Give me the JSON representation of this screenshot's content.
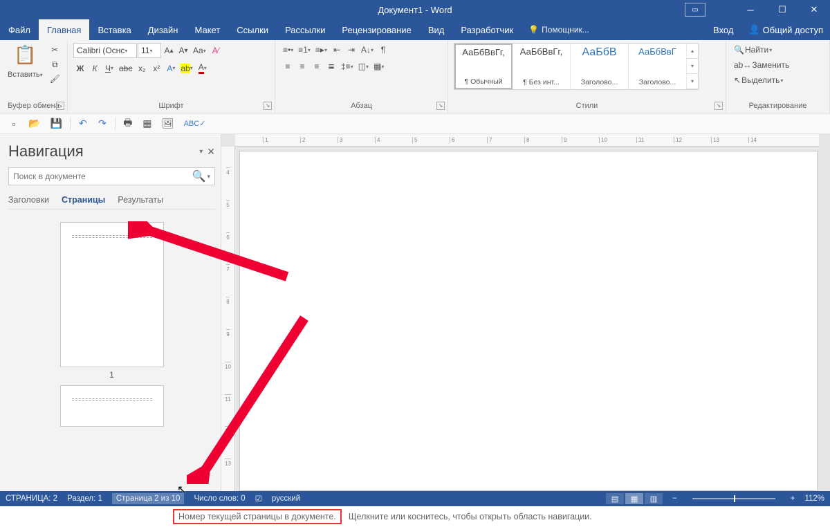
{
  "title": "Документ1 - Word",
  "tabs": {
    "file": "Файл",
    "home": "Главная",
    "insert": "Вставка",
    "design": "Дизайн",
    "layout": "Макет",
    "references": "Ссылки",
    "mailings": "Рассылки",
    "review": "Рецензирование",
    "view": "Вид",
    "developer": "Разработчик",
    "tellme": "Помощник...",
    "signin": "Вход",
    "share": "Общий доступ"
  },
  "ribbon": {
    "clipboard": {
      "label": "Буфер обмена",
      "paste": "Вставить"
    },
    "font": {
      "label": "Шрифт",
      "name": "Calibri (Оснс",
      "size": "11"
    },
    "paragraph": {
      "label": "Абзац"
    },
    "styles": {
      "label": "Стили",
      "items": [
        {
          "preview": "АаБбВвГг,",
          "name": "¶ Обычный",
          "selected": true,
          "color": "#333"
        },
        {
          "preview": "АаБбВвГг,",
          "name": "¶ Без инт...",
          "color": "#333"
        },
        {
          "preview": "АаБбВ",
          "name": "Заголово...",
          "color": "#2e74b5"
        },
        {
          "preview": "АаБбВвГ",
          "name": "Заголово...",
          "color": "#2e74b5"
        }
      ]
    },
    "editing": {
      "label": "Редактирование",
      "find": "Найти",
      "replace": "Заменить",
      "select": "Выделить"
    }
  },
  "nav": {
    "title": "Навигация",
    "search_placeholder": "Поиск в документе",
    "tabs": {
      "headings": "Заголовки",
      "pages": "Страницы",
      "results": "Результаты"
    },
    "thumb1": "1"
  },
  "ruler_h": [
    "1",
    "2",
    "3",
    "4",
    "5",
    "6",
    "7",
    "8",
    "9",
    "10",
    "11",
    "12",
    "13",
    "14"
  ],
  "ruler_v": [
    "4",
    "5",
    "6",
    "7",
    "8",
    "9",
    "10",
    "11",
    "12",
    "13"
  ],
  "status": {
    "page_label": "СТРАНИЦА: 2",
    "section": "Раздел: 1",
    "page_of": "Страница 2 из 10",
    "words": "Число слов: 0",
    "lang": "русский",
    "zoom": "112%"
  },
  "tooltip": {
    "boxed": "Номер текущей страницы в документе.",
    "rest": "Щелкните или коснитесь, чтобы открыть область навигации."
  }
}
